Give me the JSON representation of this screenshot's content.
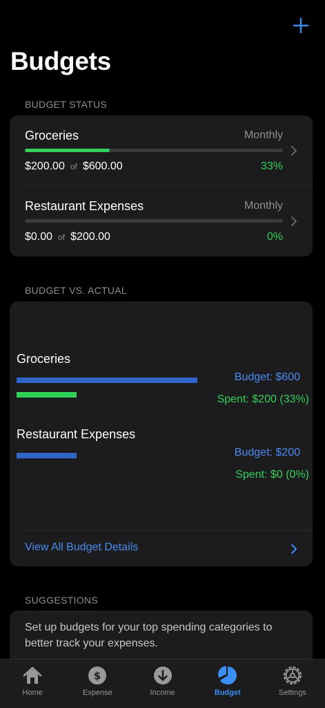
{
  "header": {
    "title": "Budgets"
  },
  "budget_status": {
    "section_title": "BUDGET STATUS",
    "of_label": "of",
    "items": [
      {
        "name": "Groceries",
        "period": "Monthly",
        "spent": "$200.00",
        "budget": "$600.00",
        "percent": "33%",
        "progress": 0.33
      },
      {
        "name": "Restaurant Expenses",
        "period": "Monthly",
        "spent": "$0.00",
        "budget": "$200.00",
        "percent": "0%",
        "progress": 0.0
      }
    ]
  },
  "budget_vs_actual": {
    "section_title": "BUDGET VS. ACTUAL",
    "items": [
      {
        "name": "Groceries",
        "budget_label": "Budget: $600",
        "spent_label": "Spent: $200 (33%)",
        "budget_value": 600,
        "spent_value": 200
      },
      {
        "name": "Restaurant Expenses",
        "budget_label": "Budget: $200",
        "spent_label": "Spent: $0 (0%)",
        "budget_value": 200,
        "spent_value": 0
      }
    ],
    "view_all_label": "View All Budget Details"
  },
  "suggestions": {
    "section_title": "SUGGESTIONS",
    "text": "Set up budgets for your top spending categories to better track your expenses."
  },
  "tabbar": {
    "tabs": [
      {
        "label": "Home",
        "icon": "home-icon",
        "active": false
      },
      {
        "label": "Expense",
        "icon": "dollar-circle-icon",
        "active": false
      },
      {
        "label": "Income",
        "icon": "arrow-down-circle-icon",
        "active": false
      },
      {
        "label": "Budget",
        "icon": "pie-chart-icon",
        "active": true
      },
      {
        "label": "Settings",
        "icon": "gear-icon",
        "active": false
      }
    ]
  },
  "colors": {
    "accent": "#3a8ef6",
    "budget_bar": "#2f64c8",
    "spent": "#30d158",
    "card": "#1c1c1e",
    "background": "#000000"
  }
}
